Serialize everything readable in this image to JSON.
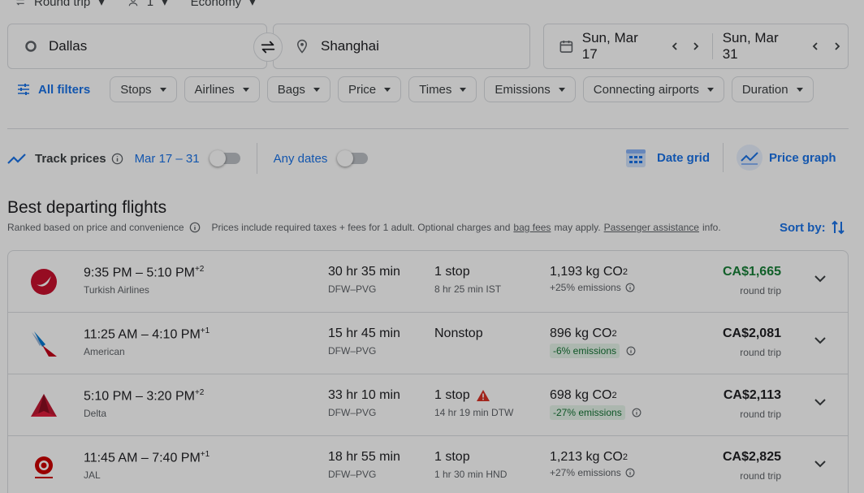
{
  "top": {
    "trip_type": "Round trip",
    "passengers": "1",
    "cabin": "Economy"
  },
  "search": {
    "origin": "Dallas",
    "destination": "Shanghai",
    "depart": "Sun, Mar 17",
    "return": "Sun, Mar 31"
  },
  "filters": {
    "all_filters": "All filters",
    "chips": [
      "Stops",
      "Airlines",
      "Bags",
      "Price",
      "Times",
      "Emissions",
      "Connecting airports",
      "Duration"
    ]
  },
  "track": {
    "label": "Track prices",
    "range": "Mar 17 – 31",
    "any_dates": "Any dates"
  },
  "views": {
    "date_grid": "Date grid",
    "price_graph": "Price graph"
  },
  "section": {
    "title": "Best departing flights",
    "ranked": "Ranked based on price and convenience",
    "prices_prefix": "Prices include required taxes + fees for 1 adult. Optional charges and",
    "bag_fees": "bag fees",
    "may_apply": "may apply.",
    "passenger_assistance": "Passenger assistance",
    "info": "info.",
    "sort_by": "Sort by:"
  },
  "flights": [
    {
      "times": "9:35 PM – 5:10 PM",
      "plus": "+2",
      "airline": "Turkish Airlines",
      "duration": "30 hr 35 min",
      "route": "DFW–PVG",
      "stops": "1 stop",
      "layover": "8 hr 25 min IST",
      "co2": "1,193 kg CO",
      "emissions": "+25% emissions",
      "price": "CA$1,665",
      "price_note": "round trip",
      "highlight": true
    },
    {
      "times": "11:25 AM – 4:10 PM",
      "plus": "+1",
      "airline": "American",
      "duration": "15 hr 45 min",
      "route": "DFW–PVG",
      "stops": "Nonstop",
      "layover": "",
      "co2": "896 kg CO",
      "emissions": "-6% emissions",
      "price": "CA$2,081",
      "price_note": "round trip",
      "highlight": false
    },
    {
      "times": "5:10 PM – 3:20 PM",
      "plus": "+2",
      "airline": "Delta",
      "duration": "33 hr 10 min",
      "route": "DFW–PVG",
      "stops": "1 stop",
      "layover": "14 hr 19 min DTW",
      "co2": "698 kg CO",
      "emissions": "-27% emissions",
      "price": "CA$2,113",
      "price_note": "round trip",
      "highlight": false
    },
    {
      "times": "11:45 AM – 7:40 PM",
      "plus": "+1",
      "airline": "JAL",
      "duration": "18 hr 55 min",
      "route": "DFW–PVG",
      "stops": "1 stop",
      "layover": "1 hr 30 min HND",
      "co2": "1,213 kg CO",
      "emissions": "+27% emissions",
      "price": "CA$2,825",
      "price_note": "round trip",
      "highlight": false
    }
  ],
  "co2_subscript": "2",
  "colors": {
    "accent": "#1a73e8",
    "good_price": "#188038",
    "low_emission_bg": "#e6f4ea",
    "warning": "#d93025"
  }
}
